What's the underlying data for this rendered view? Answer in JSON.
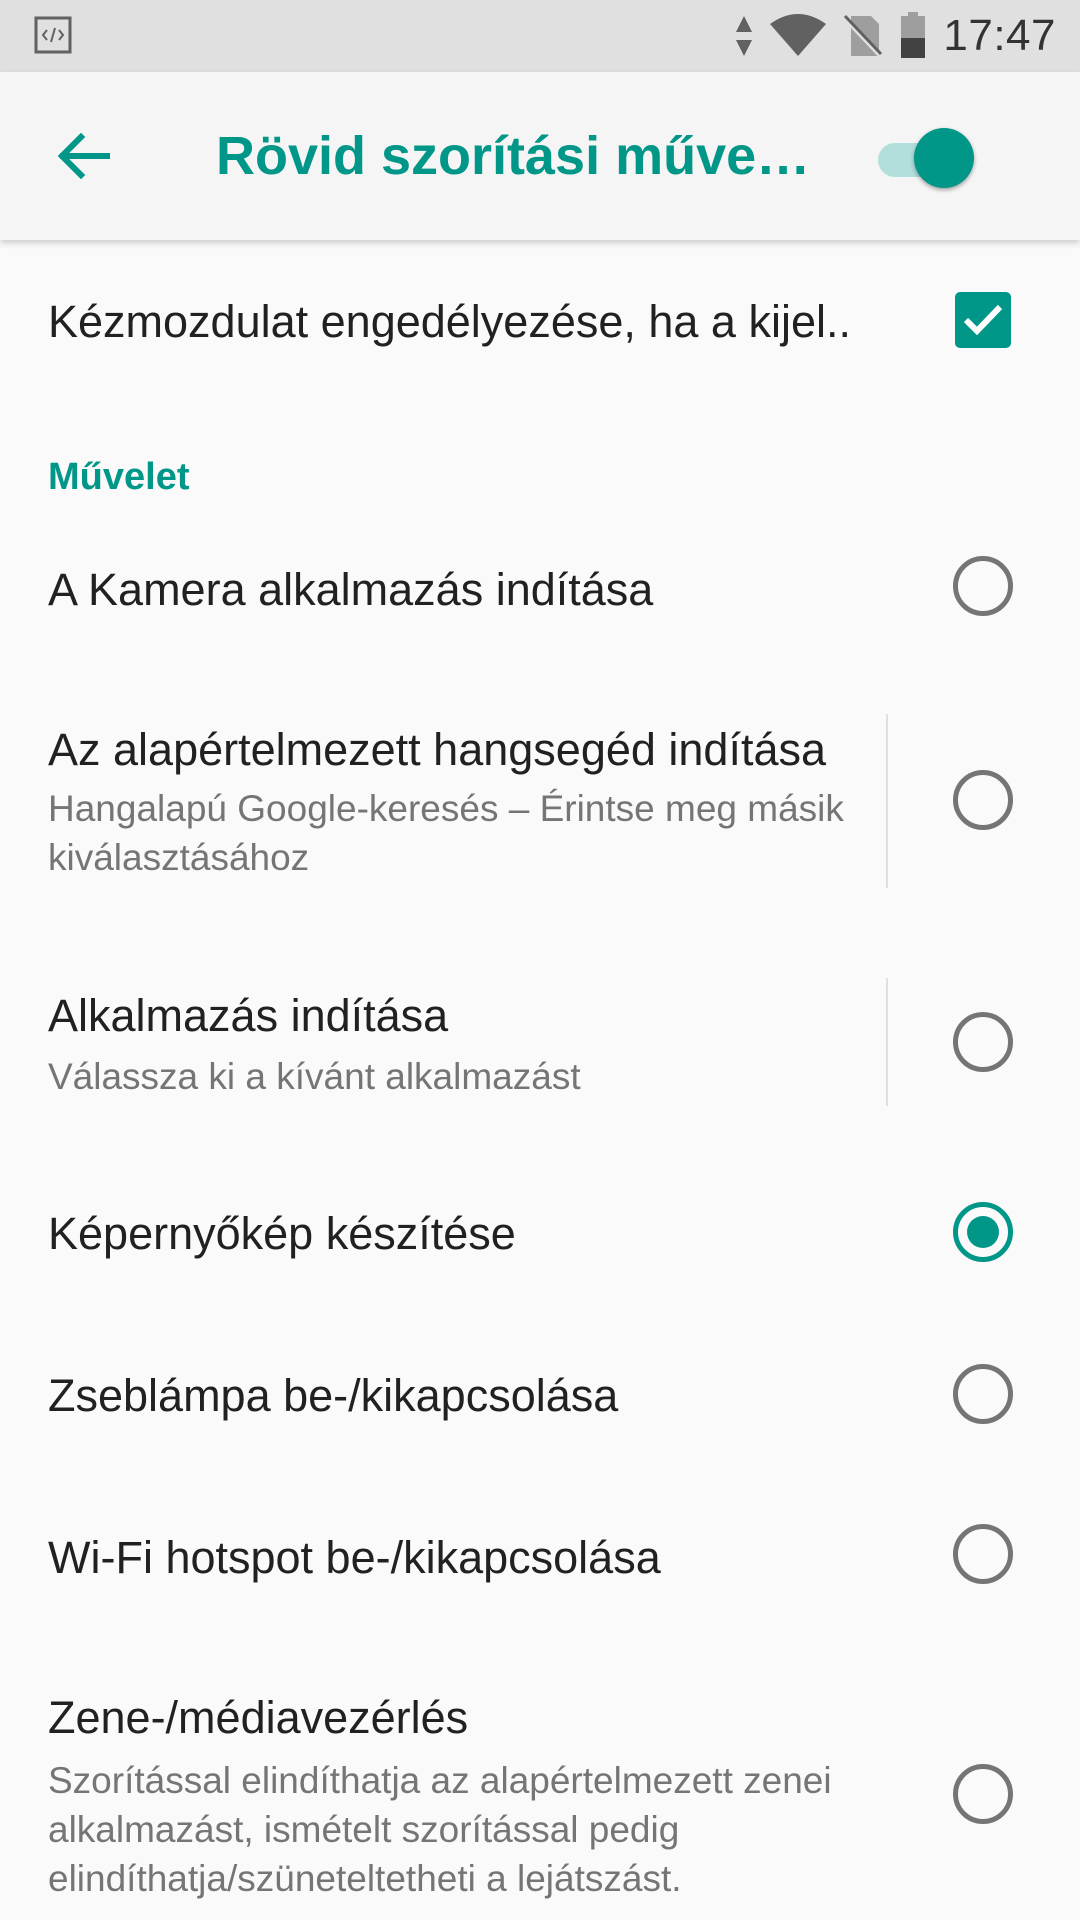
{
  "status_bar": {
    "time": "17:47",
    "icons": [
      "debug-icon",
      "data-arrows-icon",
      "wifi-icon",
      "no-sim-icon",
      "battery-icon"
    ]
  },
  "app_bar": {
    "title": "Rövid szorítási műve…",
    "master_toggle_on": true,
    "accent_color": "#009688"
  },
  "prefs": {
    "gesture_screen_off": {
      "title": "Kézmozdulat engedélyezése, ha a kijel..",
      "checked": true
    }
  },
  "section": {
    "header": "Művelet"
  },
  "options": [
    {
      "title": "A Kamera alkalmazás indítása",
      "selected": false
    },
    {
      "title": "Az alapértelmezett hangsegéd indítása",
      "summary": "Hangalapú Google-keresés – Érintse meg másik kiválasztásához",
      "selected": false
    },
    {
      "title": "Alkalmazás indítása",
      "summary": "Válassza ki a kívánt alkalmazást",
      "selected": false
    },
    {
      "title": "Képernyőkép készítése",
      "selected": true
    },
    {
      "title": "Zseblámpa be-/kikapcsolása",
      "selected": false
    },
    {
      "title": "Wi-Fi hotspot be-/kikapcsolása",
      "selected": false
    },
    {
      "title": "Zene-/médiavezérlés",
      "summary": "Szorítással elindíthatja az alapértelmezett zenei alkalmazást, ismételt szorítással pedig elindíthatja/szüneteltetheti a lejátszást.",
      "selected": false
    }
  ]
}
